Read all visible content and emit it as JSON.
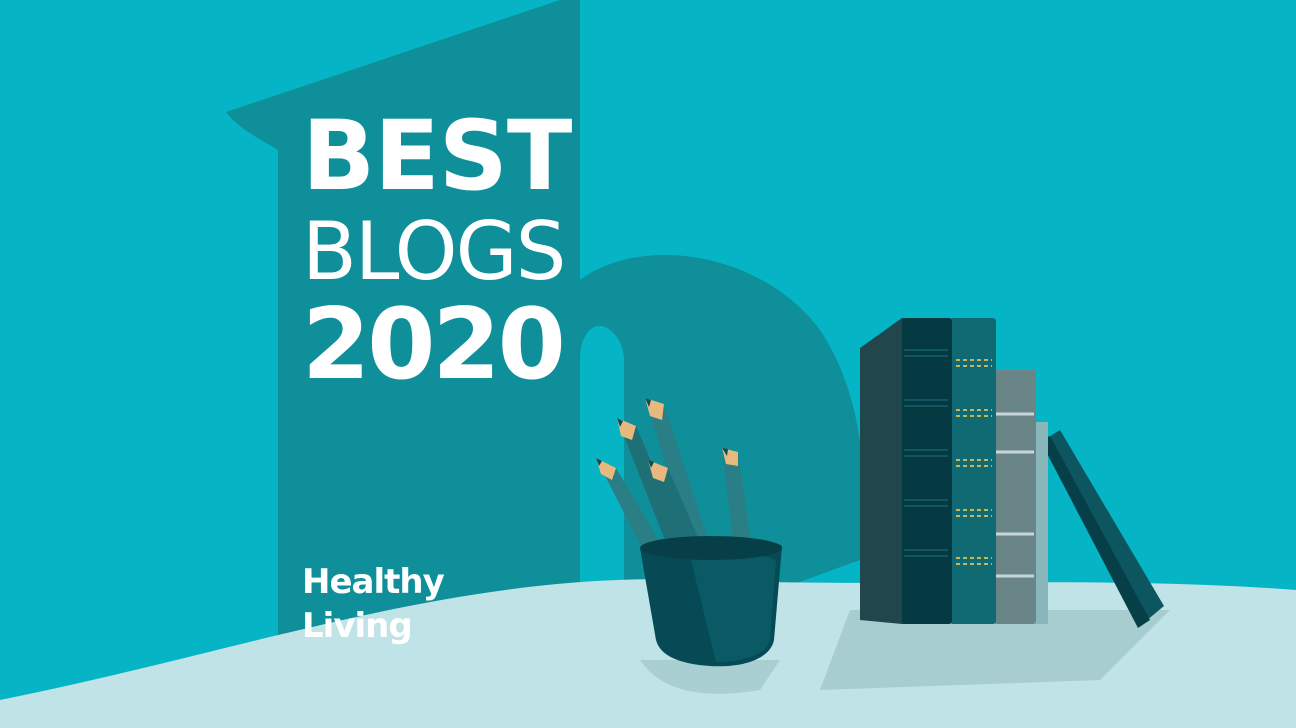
{
  "banner": {
    "title_line1": "BEST",
    "title_line2": "BLOGS",
    "title_line3": "2020",
    "category_line1": "Healthy",
    "category_line2": "Living"
  },
  "colors": {
    "background": "#05b5c5",
    "shadow": "#0e8f9a",
    "table": "#bfe3e6",
    "text": "#ffffff"
  },
  "icons": [
    "pencil-cup-illustration",
    "books-illustration"
  ]
}
